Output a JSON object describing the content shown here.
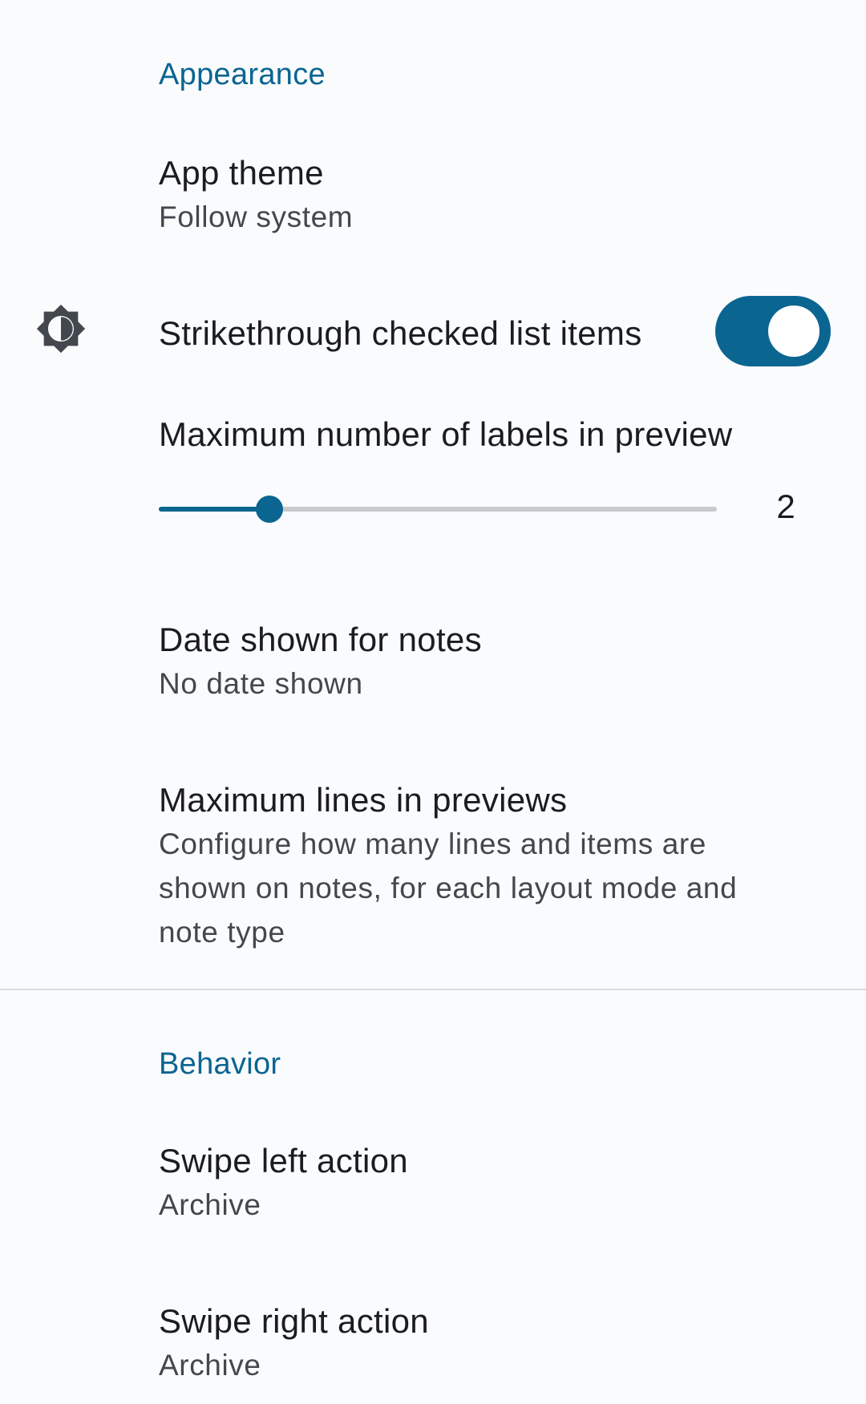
{
  "appearance": {
    "header": "Appearance",
    "app_theme": {
      "title": "App theme",
      "summary": "Follow system",
      "icon": "brightness-contrast-icon"
    },
    "strikethrough": {
      "title": "Strikethrough checked list items",
      "enabled": true
    },
    "max_labels": {
      "title": "Maximum number of labels in preview",
      "value": "2"
    },
    "date_shown": {
      "title": "Date shown for notes",
      "summary": "No date shown"
    },
    "max_lines": {
      "title": "Maximum lines in previews",
      "summary_lines": [
        "Configure how many lines and items are",
        "shown on notes, for each layout mode and",
        "note type"
      ]
    }
  },
  "behavior": {
    "header": "Behavior",
    "swipe_left": {
      "title": "Swipe left action",
      "summary": "Archive"
    },
    "swipe_right": {
      "title": "Swipe right action",
      "summary": "Archive"
    }
  },
  "colors": {
    "accent": "#0b6591",
    "background": "#fafbfd"
  }
}
